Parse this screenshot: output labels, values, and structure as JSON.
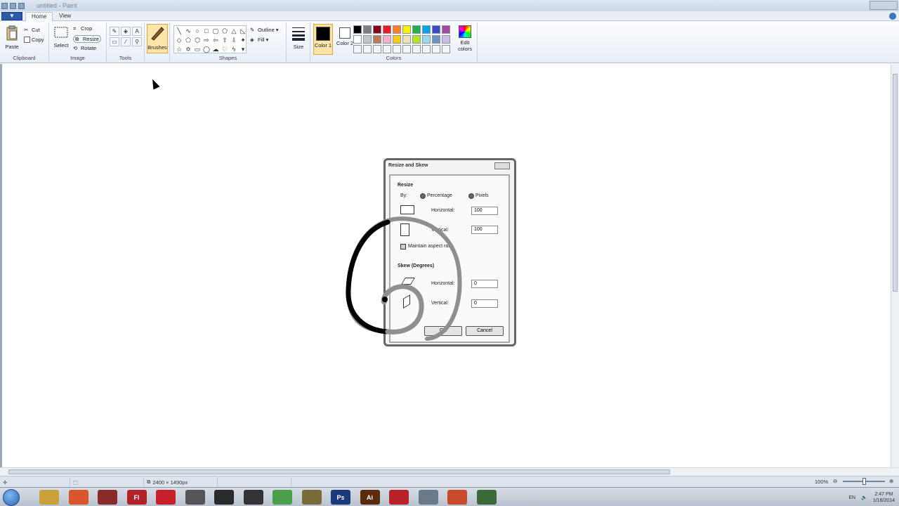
{
  "window": {
    "title": "untitled - Paint"
  },
  "tabs": [
    {
      "label": "Home",
      "active": true
    },
    {
      "label": "View",
      "active": false
    }
  ],
  "ribbon": {
    "clipboard": {
      "label": "Clipboard",
      "paste": "Paste",
      "cut": "Cut",
      "copy": "Copy"
    },
    "image": {
      "label": "Image",
      "select": "Select",
      "crop": "Crop",
      "resize": "Resize",
      "rotate": "Rotate"
    },
    "tools": {
      "label": "Tools"
    },
    "brushes": {
      "label": "Brushes"
    },
    "shapes": {
      "label": "Shapes",
      "outline": "Outline",
      "fill": "Fill"
    },
    "size": {
      "label": "Size"
    },
    "colors": {
      "label": "Colors",
      "color1": "Color 1",
      "color2": "Color 2",
      "edit": "Edit colors",
      "color1_value": "#000000",
      "color2_value": "#ffffff",
      "palette": [
        "#000000",
        "#7f7f7f",
        "#880015",
        "#ed1c24",
        "#ff7f27",
        "#fff200",
        "#22b14c",
        "#00a2e8",
        "#3f48cc",
        "#a349a4",
        "#ffffff",
        "#c3c3c3",
        "#b97a57",
        "#ffaec9",
        "#ffc90e",
        "#efe4b0",
        "#b5e61d",
        "#99d9ea",
        "#7092be",
        "#c8bfe7",
        "#f4f4f4",
        "#f4f4f4",
        "#f4f4f4",
        "#f4f4f4",
        "#f4f4f4",
        "#f4f4f4",
        "#f4f4f4",
        "#f4f4f4",
        "#f4f4f4",
        "#f4f4f4"
      ]
    }
  },
  "dialog_image": {
    "title": "Resize and Skew",
    "resize": "Resize",
    "by": "By:",
    "percentage": "Percentage",
    "pixels": "Pixels",
    "horizontal": "Horizontal:",
    "vertical": "Vertical:",
    "h_value": "100",
    "v_value": "100",
    "maintain": "Maintain aspect ratio",
    "skew": "Skew (Degrees)",
    "skew_h": "Horizontal:",
    "skew_v": "Vertical:",
    "skew_h_value": "0",
    "skew_v_value": "0",
    "ok": "OK",
    "cancel": "Cancel"
  },
  "status": {
    "size": "2400 × 1490px",
    "zoom": "100%"
  },
  "taskbar": {
    "apps": [
      {
        "name": "explorer",
        "color": "#c9a13a",
        "label": ""
      },
      {
        "name": "firefox",
        "color": "#d8562a",
        "label": ""
      },
      {
        "name": "app3",
        "color": "#8a2a2a",
        "label": ""
      },
      {
        "name": "flash",
        "color": "#b3202a",
        "label": "Fl"
      },
      {
        "name": "acrobat",
        "color": "#c8202a",
        "label": ""
      },
      {
        "name": "app6",
        "color": "#555555",
        "label": ""
      },
      {
        "name": "app7",
        "color": "#2a2a2a",
        "label": ""
      },
      {
        "name": "unity",
        "color": "#333333",
        "label": ""
      },
      {
        "name": "chrome",
        "color": "#4aa04a",
        "label": ""
      },
      {
        "name": "app10",
        "color": "#7a6a3a",
        "label": ""
      },
      {
        "name": "photoshop",
        "color": "#1a3a7a",
        "label": "Ps"
      },
      {
        "name": "illustrator",
        "color": "#5a2a0a",
        "label": "Ai"
      },
      {
        "name": "app13",
        "color": "#b8202a",
        "label": ""
      },
      {
        "name": "paint",
        "color": "#6a7a8a",
        "label": ""
      },
      {
        "name": "app15",
        "color": "#c84a2a",
        "label": ""
      },
      {
        "name": "app16",
        "color": "#3a6a3a",
        "label": ""
      }
    ],
    "lang": "EN",
    "time": "2:47 PM",
    "date": "1/16/2014"
  }
}
